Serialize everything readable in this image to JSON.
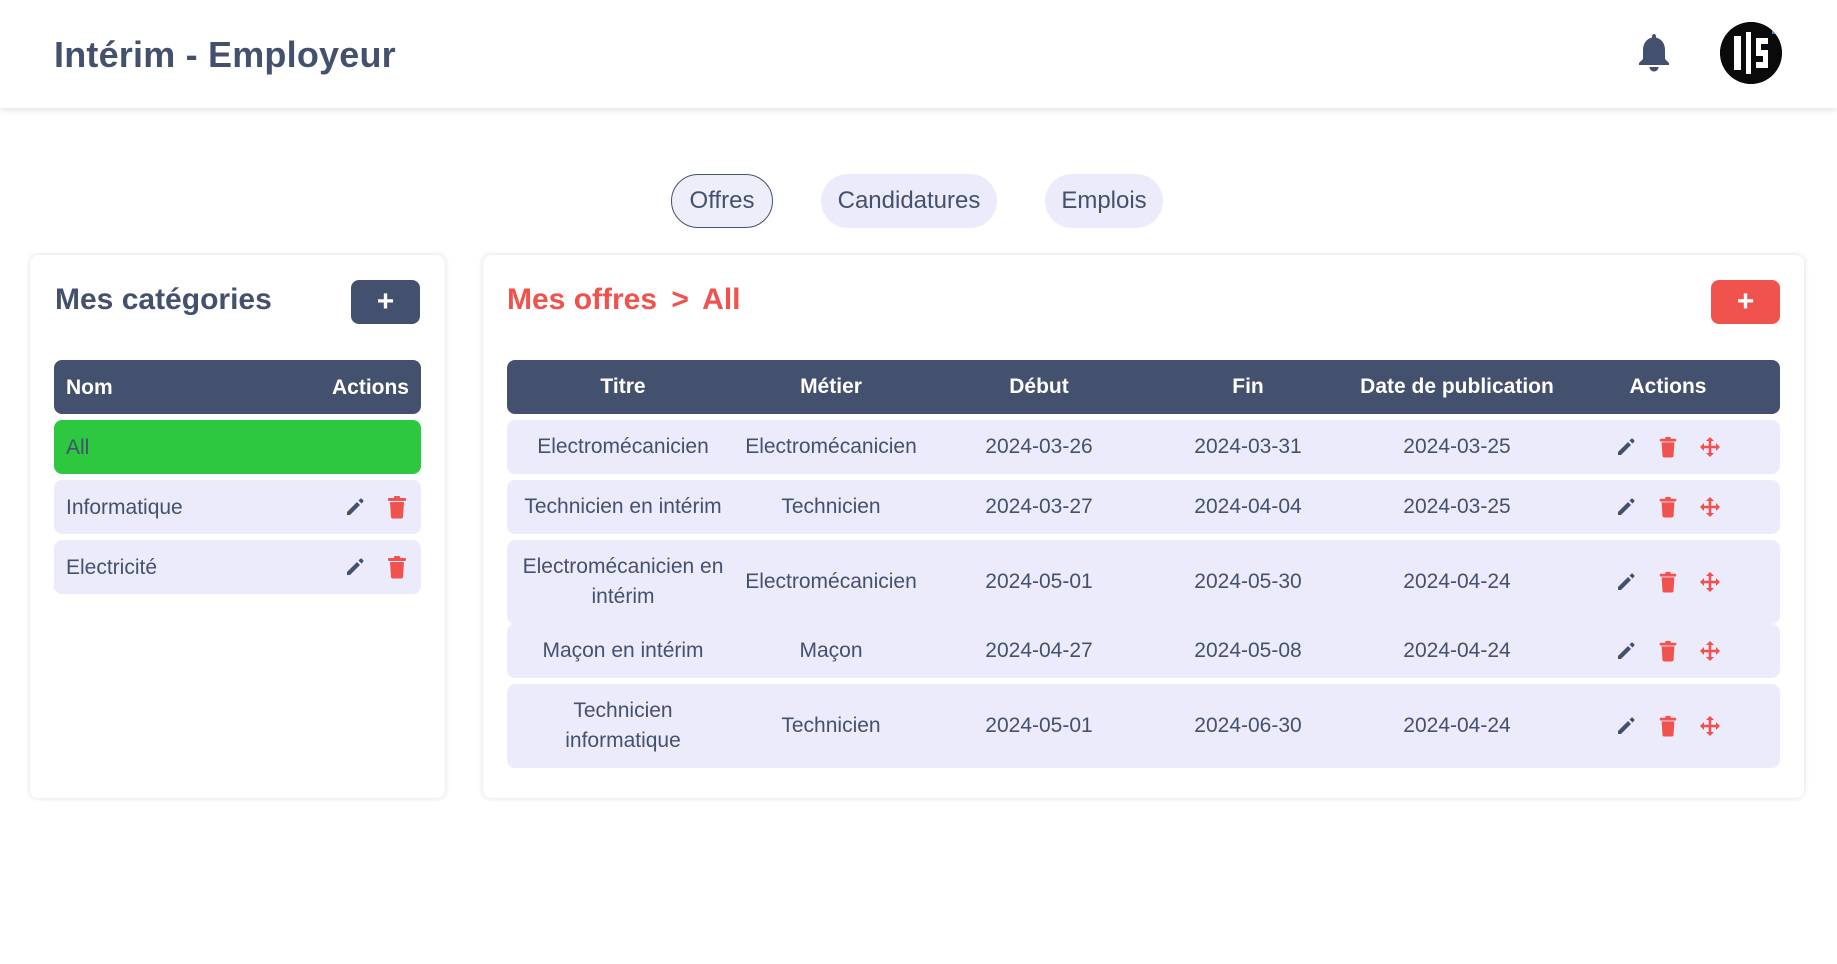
{
  "header": {
    "title": "Intérim - Employeur"
  },
  "tabs": [
    {
      "label": "Offres",
      "active": true
    },
    {
      "label": "Candidatures",
      "active": false
    },
    {
      "label": "Emplois",
      "active": false
    }
  ],
  "categories": {
    "title": "Mes catégories",
    "add_label": "+",
    "columns": {
      "name": "Nom",
      "actions": "Actions"
    },
    "items": [
      {
        "label": "All",
        "selected": true
      },
      {
        "label": "Informatique",
        "selected": false
      },
      {
        "label": "Electricité",
        "selected": false
      }
    ]
  },
  "offers": {
    "title": "Mes offres",
    "separator": ">",
    "filter": "All",
    "add_label": "+",
    "columns": [
      "Titre",
      "Métier",
      "Début",
      "Fin",
      "Date de publication",
      "Actions"
    ],
    "rows": [
      {
        "titre": "Electromécanicien",
        "metier": "Electromécanicien",
        "debut": "2024-03-26",
        "fin": "2024-03-31",
        "publication": "2024-03-25"
      },
      {
        "titre": "Technicien en intérim",
        "metier": "Technicien",
        "debut": "2024-03-27",
        "fin": "2024-04-04",
        "publication": "2024-03-25"
      },
      {
        "titre": "Electromécanicien en intérim",
        "metier": "Electromécanicien",
        "debut": "2024-05-01",
        "fin": "2024-05-30",
        "publication": "2024-04-24"
      },
      {
        "titre": "Maçon en intérim",
        "metier": "Maçon",
        "debut": "2024-04-27",
        "fin": "2024-05-08",
        "publication": "2024-04-24"
      },
      {
        "titre": "Technicien informatique",
        "metier": "Technicien",
        "debut": "2024-05-01",
        "fin": "2024-06-30",
        "publication": "2024-04-24"
      }
    ]
  },
  "icons": {
    "notification": "bell-icon",
    "avatar": "user-avatar",
    "edit": "pencil-icon",
    "delete": "trash-icon",
    "move": "move-arrows-icon"
  },
  "colors": {
    "primary": "#44516e",
    "accent": "#f0524d",
    "selected": "#2ec840",
    "row_bg": "#ecebfb"
  }
}
